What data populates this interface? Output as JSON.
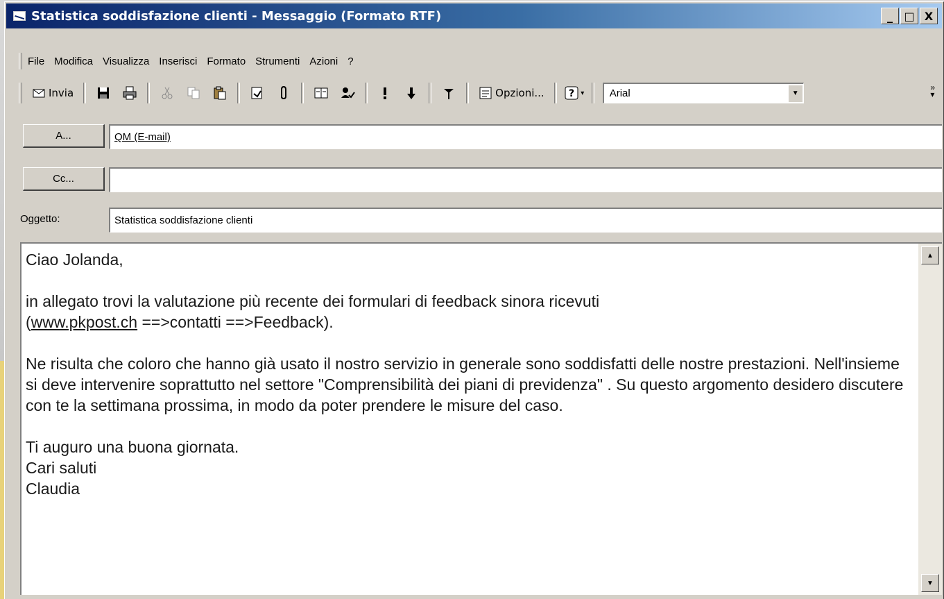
{
  "window": {
    "title": "Statistica soddisfazione clienti - Messaggio (Formato RTF)",
    "buttons": {
      "minimize": "_",
      "maximize": "□",
      "close": "X"
    }
  },
  "menu": {
    "items": [
      {
        "label": "File",
        "accel": "F"
      },
      {
        "label": "Modifica",
        "accel": "M"
      },
      {
        "label": "Visualizza",
        "accel": "V"
      },
      {
        "label": "Inserisci",
        "accel": "I"
      },
      {
        "label": "Formato",
        "accel": "o"
      },
      {
        "label": "Strumenti",
        "accel": "S"
      },
      {
        "label": "Azioni",
        "accel": "z"
      },
      {
        "label": "?",
        "accel": "?"
      }
    ]
  },
  "toolbar": {
    "send_label": "Invia",
    "options_label": "Opzioni...",
    "font": "Arial",
    "icons": [
      "send-icon",
      "save-icon",
      "print-icon",
      "cut-icon",
      "copy-icon",
      "paste-icon",
      "insert-file-icon",
      "attach-icon",
      "address-book-icon",
      "check-names-icon",
      "importance-high-icon",
      "importance-low-icon",
      "flag-icon",
      "options-icon",
      "help-icon"
    ]
  },
  "header": {
    "to_button": "A...",
    "to_value": "QM (E-mail)",
    "cc_button": "Cc...",
    "cc_value": "",
    "subject_label": "Oggetto:",
    "subject_value": "Statistica soddisfazione clienti"
  },
  "message": {
    "greeting": "Ciao Jolanda,",
    "p1_line1": "in allegato trovi la valutazione più recente dei formulari di feedback sinora ricevuti",
    "p1_link": "www.pkpost.ch",
    "p1_line2_rest": " ==>contatti ==>Feedback).",
    "p2": "Ne risulta che coloro che hanno già usato il nostro servizio in generale sono soddisfatti delle nostre prestazioni. Nell'insieme si deve intervenire soprattutto nel settore  \"Comprensibilità dei piani di previdenza\" . Su questo argomento desidero discutere con te la settimana prossima, in modo da poter prendere le misure del caso.",
    "closing1": "Ti auguro una buona giornata.",
    "closing2": "Cari saluti",
    "signature": "Claudia"
  }
}
